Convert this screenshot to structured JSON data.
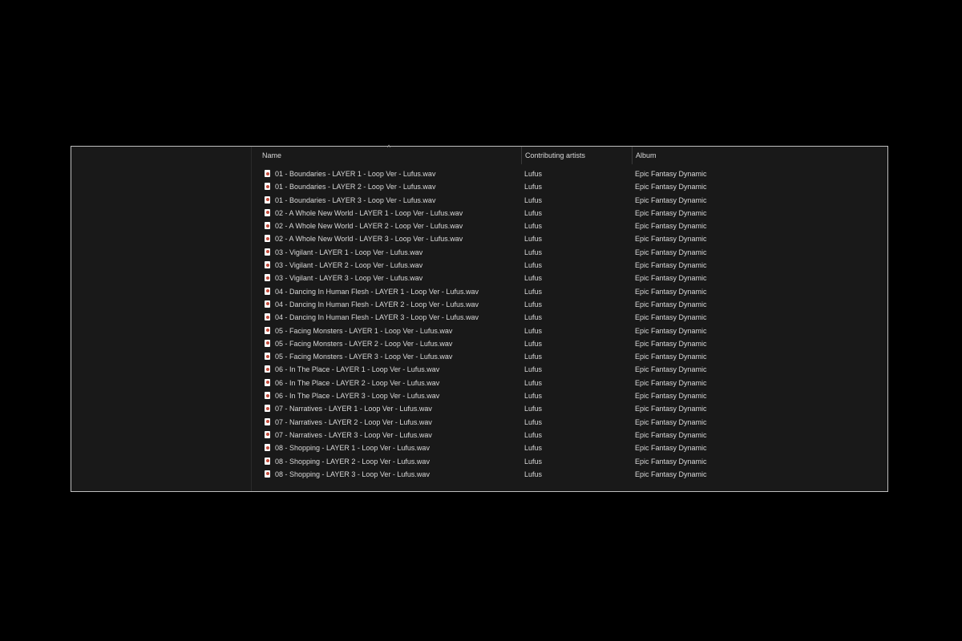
{
  "columns": {
    "name": "Name",
    "artists": "Contributing artists",
    "album": "Album",
    "sort_indicator": "^"
  },
  "files": [
    {
      "name": "01 - Boundaries - LAYER 1 - Loop Ver - Lufus.wav",
      "artist": "Lufus",
      "album": "Epic Fantasy Dynamic",
      "icon": "audio-file-icon"
    },
    {
      "name": "01 - Boundaries - LAYER 2 - Loop Ver - Lufus.wav",
      "artist": "Lufus",
      "album": "Epic Fantasy Dynamic",
      "icon": "audio-file-icon"
    },
    {
      "name": "01 - Boundaries - LAYER 3 - Loop Ver - Lufus.wav",
      "artist": "Lufus",
      "album": "Epic Fantasy Dynamic",
      "icon": "audio-file-icon"
    },
    {
      "name": "02 - A Whole New World - LAYER 1 - Loop Ver - Lufus.wav",
      "artist": "Lufus",
      "album": "Epic Fantasy Dynamic",
      "icon": "audio-file-icon"
    },
    {
      "name": "02 - A Whole New World - LAYER 2 - Loop Ver - Lufus.wav",
      "artist": "Lufus",
      "album": "Epic Fantasy Dynamic",
      "icon": "audio-file-icon"
    },
    {
      "name": "02 - A Whole New World - LAYER 3 - Loop Ver - Lufus.wav",
      "artist": "Lufus",
      "album": "Epic Fantasy Dynamic",
      "icon": "audio-file-icon"
    },
    {
      "name": "03 - Vigilant - LAYER 1 - Loop Ver - Lufus.wav",
      "artist": "Lufus",
      "album": "Epic Fantasy Dynamic",
      "icon": "audio-file-icon"
    },
    {
      "name": "03 - Vigilant - LAYER 2 - Loop Ver - Lufus.wav",
      "artist": "Lufus",
      "album": "Epic Fantasy Dynamic",
      "icon": "audio-file-icon"
    },
    {
      "name": "03 - Vigilant - LAYER 3 - Loop Ver - Lufus.wav",
      "artist": "Lufus",
      "album": "Epic Fantasy Dynamic",
      "icon": "audio-file-icon"
    },
    {
      "name": "04 - Dancing In Human Flesh - LAYER 1 - Loop Ver - Lufus.wav",
      "artist": "Lufus",
      "album": "Epic Fantasy Dynamic",
      "icon": "audio-file-icon"
    },
    {
      "name": "04 - Dancing In Human Flesh - LAYER 2 - Loop Ver - Lufus.wav",
      "artist": "Lufus",
      "album": "Epic Fantasy Dynamic",
      "icon": "audio-file-icon"
    },
    {
      "name": "04 - Dancing In Human Flesh - LAYER 3 - Loop Ver - Lufus.wav",
      "artist": "Lufus",
      "album": "Epic Fantasy Dynamic",
      "icon": "audio-file-icon"
    },
    {
      "name": "05 - Facing Monsters - LAYER 1 - Loop Ver - Lufus.wav",
      "artist": "Lufus",
      "album": "Epic Fantasy Dynamic",
      "icon": "audio-file-icon"
    },
    {
      "name": "05 - Facing Monsters - LAYER 2 - Loop Ver - Lufus.wav",
      "artist": "Lufus",
      "album": "Epic Fantasy Dynamic",
      "icon": "audio-file-icon"
    },
    {
      "name": "05 - Facing Monsters - LAYER 3 - Loop Ver - Lufus.wav",
      "artist": "Lufus",
      "album": "Epic Fantasy Dynamic",
      "icon": "audio-file-icon"
    },
    {
      "name": "06 - In The Place - LAYER 1 - Loop Ver - Lufus.wav",
      "artist": "Lufus",
      "album": "Epic Fantasy Dynamic",
      "icon": "audio-file-icon"
    },
    {
      "name": "06 - In The Place - LAYER 2 - Loop Ver - Lufus.wav",
      "artist": "Lufus",
      "album": "Epic Fantasy Dynamic",
      "icon": "audio-file-icon"
    },
    {
      "name": "06 - In The Place - LAYER 3 - Loop Ver - Lufus.wav",
      "artist": "Lufus",
      "album": "Epic Fantasy Dynamic",
      "icon": "audio-file-icon"
    },
    {
      "name": "07 - Narratives - LAYER 1 - Loop Ver - Lufus.wav",
      "artist": "Lufus",
      "album": "Epic Fantasy Dynamic",
      "icon": "audio-file-icon"
    },
    {
      "name": "07 - Narratives - LAYER 2 - Loop Ver - Lufus.wav",
      "artist": "Lufus",
      "album": "Epic Fantasy Dynamic",
      "icon": "audio-file-icon"
    },
    {
      "name": "07 - Narratives - LAYER 3 - Loop Ver - Lufus.wav",
      "artist": "Lufus",
      "album": "Epic Fantasy Dynamic",
      "icon": "audio-file-icon"
    },
    {
      "name": "08 - Shopping - LAYER 1 - Loop Ver - Lufus.wav",
      "artist": "Lufus",
      "album": "Epic Fantasy Dynamic",
      "icon": "audio-file-icon"
    },
    {
      "name": "08 - Shopping - LAYER 2 - Loop Ver - Lufus.wav",
      "artist": "Lufus",
      "album": "Epic Fantasy Dynamic",
      "icon": "audio-file-icon"
    },
    {
      "name": "08 - Shopping - LAYER 3 - Loop Ver - Lufus.wav",
      "artist": "Lufus",
      "album": "Epic Fantasy Dynamic",
      "icon": "audio-file-icon"
    }
  ],
  "colors": {
    "page_background": "#000000",
    "window_background": "#191919",
    "window_border": "#bfbfbf",
    "text": "#d9d9d9",
    "icon_accent": "#c24a3a"
  }
}
